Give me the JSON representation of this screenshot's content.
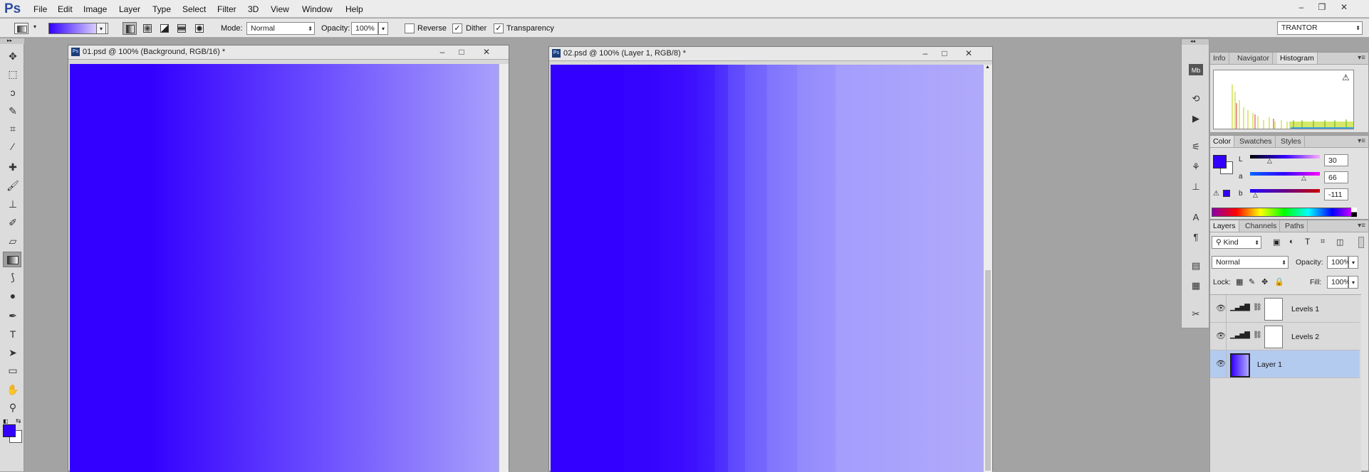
{
  "app": {
    "logo": "Ps"
  },
  "menu": [
    "File",
    "Edit",
    "Image",
    "Layer",
    "Type",
    "Select",
    "Filter",
    "3D",
    "View",
    "Window",
    "Help"
  ],
  "window_controls": {
    "min": "–",
    "restore": "❐",
    "close": "✕"
  },
  "options": {
    "mode_label": "Mode:",
    "mode_value": "Normal",
    "opacity_label": "Opacity:",
    "opacity_value": "100%",
    "reverse_label": "Reverse",
    "reverse_checked": false,
    "dither_label": "Dither",
    "dither_checked": true,
    "transparency_label": "Transparency",
    "transparency_checked": true,
    "workspace": "TRANTOR",
    "gradient_colors": [
      "#3300ff",
      "#ffffff"
    ]
  },
  "documents": [
    {
      "title": "01.psd @ 100% (Background, RGB/16) *",
      "gradient": "smooth"
    },
    {
      "title": "02.psd @ 100% (Layer 1, RGB/8) *",
      "gradient": "banded"
    }
  ],
  "panels": {
    "info_group": {
      "tabs": [
        "Info",
        "Navigator",
        "Histogram"
      ],
      "active": "Histogram",
      "warning_icon": "warning-icon"
    },
    "color_group": {
      "tabs": [
        "Color",
        "Swatches",
        "Styles"
      ],
      "active": "Color",
      "sliders": [
        {
          "label": "L",
          "value": "30"
        },
        {
          "label": "a",
          "value": "66"
        },
        {
          "label": "b",
          "value": "-111"
        }
      ],
      "foreground": "#3300ff",
      "background": "#ffffff"
    },
    "layers_group": {
      "tabs": [
        "Layers",
        "Channels",
        "Paths"
      ],
      "active": "Layers",
      "filter_kind": "Kind",
      "blend_mode": "Normal",
      "opacity_label": "Opacity:",
      "opacity_value": "100%",
      "lock_label": "Lock:",
      "fill_label": "Fill:",
      "fill_value": "100%",
      "layers": [
        {
          "name": "Levels 1",
          "type": "adjustment",
          "selected": false
        },
        {
          "name": "Levels 2",
          "type": "adjustment",
          "selected": false
        },
        {
          "name": "Layer 1",
          "type": "pixel",
          "selected": true
        }
      ]
    }
  },
  "colors": {
    "accent": "#3300ff",
    "selection": "#b4cbf0"
  }
}
